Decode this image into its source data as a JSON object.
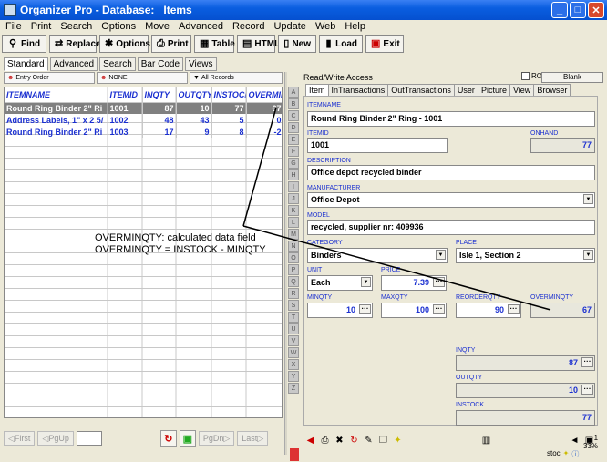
{
  "window": {
    "title": "Organizer Pro - Database: _Items"
  },
  "menu": [
    "File",
    "Print",
    "Search",
    "Options",
    "Move",
    "Advanced",
    "Record",
    "Update",
    "Web",
    "Help"
  ],
  "toolbar": [
    {
      "label": "Find",
      "icon": "magnifier-icon"
    },
    {
      "label": "Replace",
      "icon": "replace-icon"
    },
    {
      "label": "Options",
      "icon": "options-icon"
    },
    {
      "label": "Print",
      "icon": "printer-icon"
    },
    {
      "label": "Table",
      "icon": "table-icon"
    },
    {
      "label": "HTML",
      "icon": "html-icon"
    },
    {
      "label": "New",
      "icon": "new-document-icon"
    },
    {
      "label": "Load",
      "icon": "load-icon"
    },
    {
      "label": "Exit",
      "icon": "exit-icon"
    }
  ],
  "modetabs": [
    "Standard",
    "Advanced",
    "Search",
    "Bar Code",
    "Views"
  ],
  "filters": {
    "order": "Entry Order",
    "none": "NONE",
    "records": "All Records"
  },
  "grid": {
    "columns": [
      "ITEMNAME",
      "ITEMID",
      "INQTY",
      "OUTQTY",
      "INSTOCK",
      "OVERMIN"
    ],
    "rows": [
      [
        "Round Ring Binder 2\" Ri",
        "1001",
        "87",
        "10",
        "77",
        "67"
      ],
      [
        "Address Labels, 1\" x 2 5/",
        "1002",
        "48",
        "43",
        "5",
        "0"
      ],
      [
        "Round Ring Binder 2\" Ri",
        "1003",
        "17",
        "9",
        "8",
        "-2"
      ]
    ]
  },
  "nav": {
    "first": "First",
    "pgup": "PgUp",
    "pgdn": "PgDn",
    "last": "Last"
  },
  "alphabet": [
    "A",
    "B",
    "C",
    "D",
    "E",
    "F",
    "G",
    "H",
    "I",
    "J",
    "K",
    "L",
    "M",
    "N",
    "O",
    "P",
    "Q",
    "R",
    "S",
    "T",
    "U",
    "V",
    "W",
    "X",
    "Y",
    "Z"
  ],
  "right": {
    "access": "Read/Write Access",
    "ro": "RO",
    "blank": "Blank",
    "tabs": [
      "Item",
      "InTransactions",
      "OutTransactions",
      "User",
      "Picture",
      "View",
      "Browser"
    ],
    "fields": {
      "itemname_label": "ITEMNAME",
      "itemname": "Round Ring Binder 2\" Ring - 1001",
      "itemid_label": "ITEMID",
      "itemid": "1001",
      "onhand_label": "ONHAND",
      "onhand": "77",
      "description_label": "DESCRIPTION",
      "description": "Office depot recycled binder",
      "manufacturer_label": "MANUFACTURER",
      "manufacturer": "Office Depot",
      "model_label": "MODEL",
      "model": "recycled, supplier nr: 409936",
      "category_label": "CATEGORY",
      "category": "Binders",
      "place_label": "PLACE",
      "place": "Isle 1, Section 2",
      "unit_label": "UNIT",
      "unit": "Each",
      "price_label": "PRICE",
      "price": "7.39",
      "minqty_label": "MINQTY",
      "minqty": "10",
      "maxqty_label": "MAXQTY",
      "maxqty": "100",
      "reorderqty_label": "REORDERQTY",
      "reorderqty": "90",
      "overminqty_label": "OVERMINQTY",
      "overminqty": "67",
      "inqty_label": "INQTY",
      "inqty": "87",
      "outqty_label": "OUTQTY",
      "outqty": "10",
      "instock_label": "INSTOCK",
      "instock": "77"
    },
    "percent_top": "1",
    "percent": "33%",
    "status": "stoc"
  },
  "annotation": {
    "line1": "OVERMINQTY: calculated data field",
    "line2": "OVERMINQTY = INSTOCK - MINQTY"
  }
}
